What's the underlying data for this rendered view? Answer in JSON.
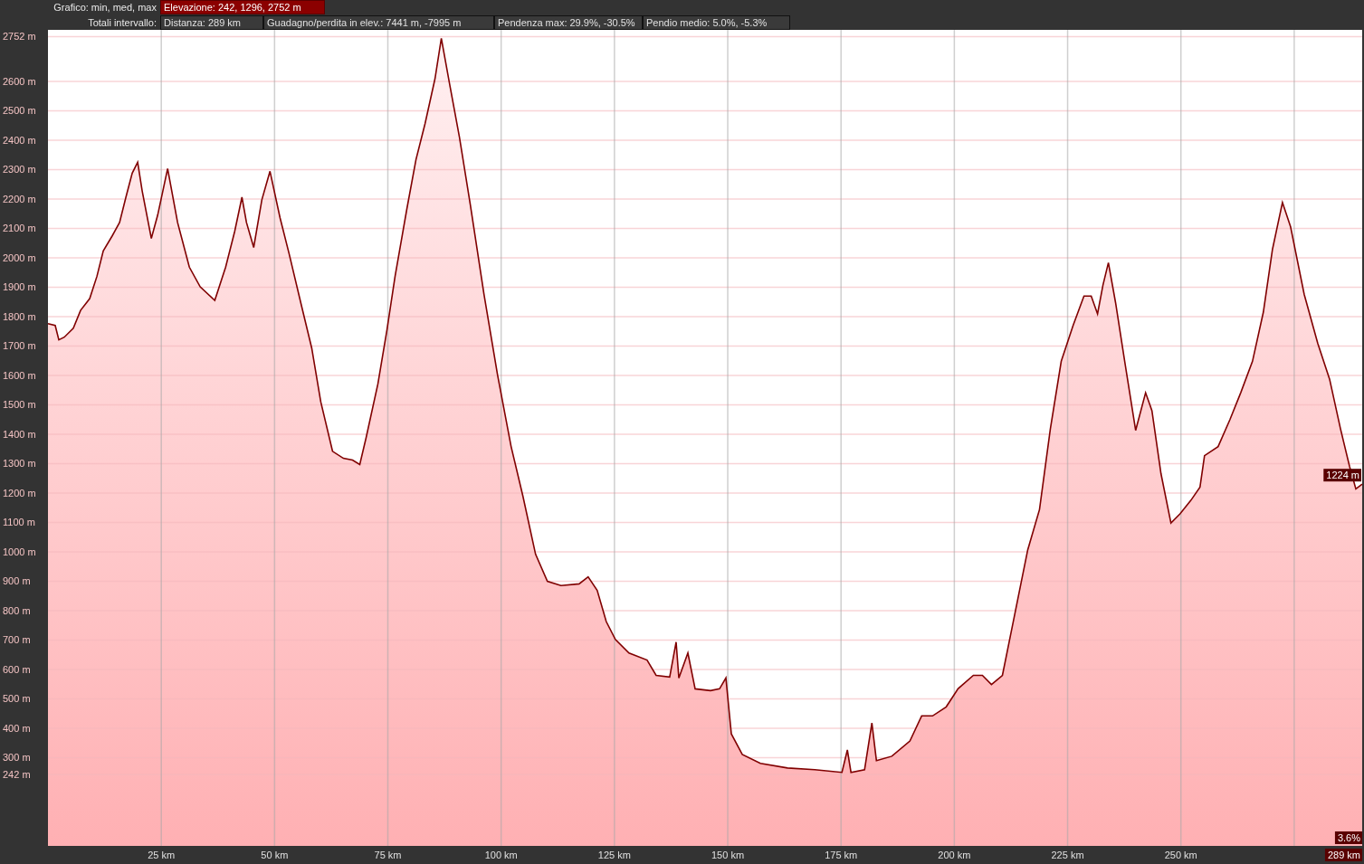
{
  "header": {
    "rows": [
      {
        "label": "Grafico: min, med, max",
        "items": [
          {
            "text": "Elevazione: 242, 1296, 2752 m",
            "kind": "highlight"
          }
        ]
      },
      {
        "label": "Totali intervallo:",
        "items": [
          {
            "text": "Distanza: 289 km",
            "kind": "plain"
          },
          {
            "text": "Guadagno/perdita in elev.: 7441 m, -7995 m",
            "kind": "plain"
          },
          {
            "text": "Pendenza max: 29.9%, -30.5%",
            "kind": "plain"
          },
          {
            "text": "Pendio medio: 5.0%, -5.3%",
            "kind": "plain"
          }
        ]
      }
    ]
  },
  "chart": {
    "chart_data": {
      "type": "area",
      "xlim": [
        0,
        290
      ],
      "ylim": [
        0,
        2775
      ],
      "xticks": [
        {
          "value": 25,
          "label": "25 km"
        },
        {
          "value": 50,
          "label": "50 km"
        },
        {
          "value": 75,
          "label": "75 km"
        },
        {
          "value": 100,
          "label": "100 km"
        },
        {
          "value": 125,
          "label": "125 km"
        },
        {
          "value": 150,
          "label": "150 km"
        },
        {
          "value": 175,
          "label": "175 km"
        },
        {
          "value": 200,
          "label": "200 km"
        },
        {
          "value": 225,
          "label": "225 km"
        },
        {
          "value": 250,
          "label": "250 km"
        }
      ],
      "yticks": [
        {
          "value": 242,
          "label": "242 m"
        },
        {
          "value": 300,
          "label": "300 m"
        },
        {
          "value": 400,
          "label": "400 m"
        },
        {
          "value": 500,
          "label": "500 m"
        },
        {
          "value": 600,
          "label": "600 m"
        },
        {
          "value": 700,
          "label": "700 m"
        },
        {
          "value": 800,
          "label": "800 m"
        },
        {
          "value": 900,
          "label": "900 m"
        },
        {
          "value": 1000,
          "label": "1000 m"
        },
        {
          "value": 1100,
          "label": "1100 m"
        },
        {
          "value": 1200,
          "label": "1200 m"
        },
        {
          "value": 1300,
          "label": "1300 m"
        },
        {
          "value": 1400,
          "label": "1400 m"
        },
        {
          "value": 1500,
          "label": "1500 m"
        },
        {
          "value": 1600,
          "label": "1600 m"
        },
        {
          "value": 1700,
          "label": "1700 m"
        },
        {
          "value": 1800,
          "label": "1800 m"
        },
        {
          "value": 1900,
          "label": "1900 m"
        },
        {
          "value": 2000,
          "label": "2000 m"
        },
        {
          "value": 2100,
          "label": "2100 m"
        },
        {
          "value": 2200,
          "label": "2200 m"
        },
        {
          "value": 2300,
          "label": "2300 m"
        },
        {
          "value": 2400,
          "label": "2400 m"
        },
        {
          "value": 2500,
          "label": "2500 m"
        },
        {
          "value": 2600,
          "label": "2600 m"
        },
        {
          "value": 2752,
          "label": "2752 m"
        }
      ],
      "x": [
        0,
        1.6,
        2.4,
        3.6,
        5.6,
        7.2,
        9.2,
        10.8,
        12.2,
        14.2,
        15.8,
        17.2,
        18.6,
        19.8,
        20.8,
        22.8,
        24.2,
        26.4,
        28.6,
        31.2,
        33.6,
        36.8,
        39.2,
        41.2,
        42.8,
        43.8,
        45.4,
        47.2,
        49,
        51.2,
        53.2,
        55.8,
        58.2,
        60.2,
        62.8,
        65.2,
        67.2,
        68.8,
        70.2,
        72.8,
        74.8,
        76.6,
        79.2,
        81.2,
        83.2,
        85.4,
        86.8,
        88.6,
        90.8,
        93.2,
        96.2,
        99.2,
        102.2,
        104.8,
        107.6,
        110.2,
        113.2,
        117.2,
        119.2,
        121.2,
        123.2,
        125.2,
        128.2,
        132.2,
        134.2,
        137.2,
        138.6,
        139.2,
        141.2,
        142.8,
        146.2,
        148.2,
        149.6,
        150.8,
        153.2,
        157.2,
        163.2,
        169.2,
        175.2,
        176.4,
        177.2,
        180.2,
        181.8,
        182.8,
        186.2,
        190.2,
        192.8,
        195.2,
        198.2,
        200.8,
        204.2,
        206.2,
        208.2,
        210.6,
        213.2,
        216.2,
        218.8,
        221.2,
        223.6,
        226.2,
        228.6,
        230.2,
        231.6,
        232.8,
        234,
        235.6,
        237.6,
        240,
        242.2,
        243.6,
        245.6,
        247.8,
        249.8,
        252.2,
        254.2,
        255.2,
        258.2,
        260.8,
        263.2,
        265.8,
        268.2,
        270.2,
        272.4,
        274.2,
        277.2,
        280.2,
        282.8,
        285.2,
        287.2,
        288.6,
        290
      ],
      "grid": true,
      "series": [
        {
          "color": "#800000",
          "values": [
            1776,
            1770,
            1721,
            1730,
            1760,
            1821,
            1861,
            1937,
            2023,
            2075,
            2120,
            2206,
            2288,
            2325,
            2227,
            2066,
            2145,
            2303,
            2120,
            1968,
            1901,
            1855,
            1968,
            2090,
            2206,
            2120,
            2035,
            2197,
            2294,
            2136,
            2014,
            1846,
            1693,
            1510,
            1342,
            1318,
            1312,
            1297,
            1388,
            1571,
            1754,
            1937,
            2166,
            2334,
            2456,
            2609,
            2746,
            2593,
            2410,
            2181,
            1876,
            1602,
            1358,
            1190,
            992,
            900,
            885,
            891,
            915,
            869,
            763,
            702,
            656,
            632,
            580,
            574,
            693,
            571,
            656,
            534,
            528,
            534,
            571,
            381,
            311,
            281,
            265,
            259,
            250,
            326,
            250,
            259,
            418,
            290,
            305,
            357,
            442,
            442,
            473,
            534,
            580,
            580,
            549,
            580,
            778,
            1007,
            1144,
            1419,
            1648,
            1770,
            1870,
            1870,
            1809,
            1907,
            1983,
            1846,
            1648,
            1413,
            1541,
            1480,
            1266,
            1098,
            1129,
            1175,
            1220,
            1327,
            1358,
            1449,
            1541,
            1648,
            1815,
            2029,
            2188,
            2105,
            1876,
            1709,
            1587,
            1419,
            1291,
            1214,
            1230
          ]
        }
      ],
      "annotations": [
        "1224 m",
        "3.6%",
        "289 km"
      ]
    }
  }
}
